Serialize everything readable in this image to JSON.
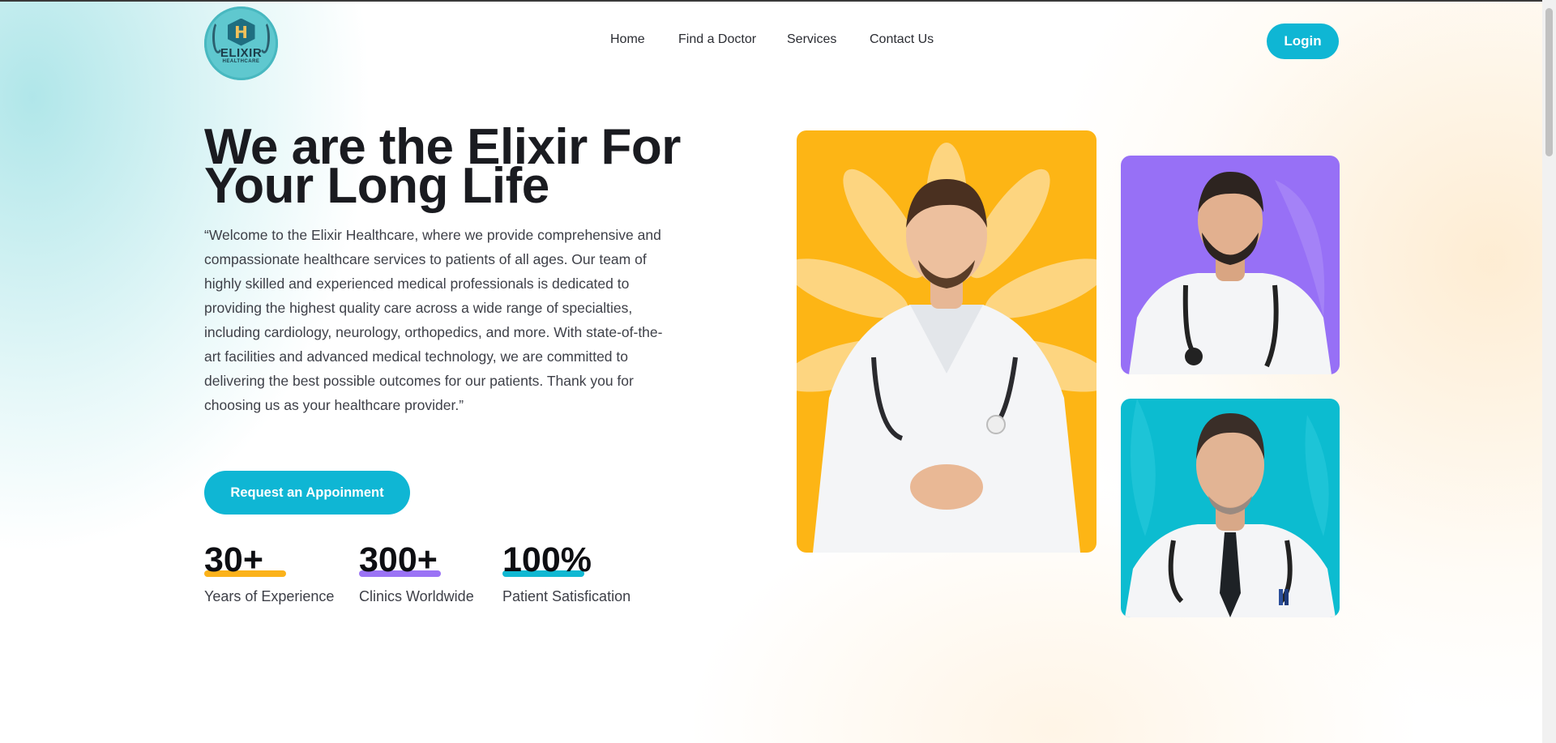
{
  "header": {
    "logo": {
      "brand": "ELIXIR",
      "sub": "HEALTHCARE",
      "mark": "H"
    },
    "nav": [
      {
        "label": "Home"
      },
      {
        "label": "Find a Doctor"
      },
      {
        "label": "Services"
      },
      {
        "label": "Contact Us"
      }
    ],
    "login_label": "Login"
  },
  "hero": {
    "title": "We are the Elixir For Your Long Life",
    "text": "“Welcome to the Elixir Healthcare, where we provide comprehensive and compassionate healthcare services to patients of all ages. Our team of highly skilled and experienced medical professionals is dedicated to providing the highest quality care across a wide range of specialties, including cardiology, neurology, orthopedics, and more. With state-of-the-art facilities and advanced medical technology, we are committed to delivering the best possible outcomes for our patients. Thank you for choosing us as your healthcare provider.”",
    "cta_label": "Request an Appoinment"
  },
  "stats": [
    {
      "value": "30+",
      "label": "Years of Experience",
      "color": "#fbb21a"
    },
    {
      "value": "300+",
      "label": "Clinics Worldwide",
      "color": "#9b73f5"
    },
    {
      "value": "100%",
      "label": "Patient Satisfication",
      "color": "#10b8d2"
    }
  ],
  "doctor_cards": [
    {
      "name": "doctor-card-main",
      "bg": "#fdb515"
    },
    {
      "name": "doctor-card-purple",
      "bg": "#9770f6"
    },
    {
      "name": "doctor-card-teal",
      "bg": "#0cbcd0"
    }
  ],
  "colors": {
    "accent": "#0fb6d4",
    "text": "#1a1b20"
  }
}
